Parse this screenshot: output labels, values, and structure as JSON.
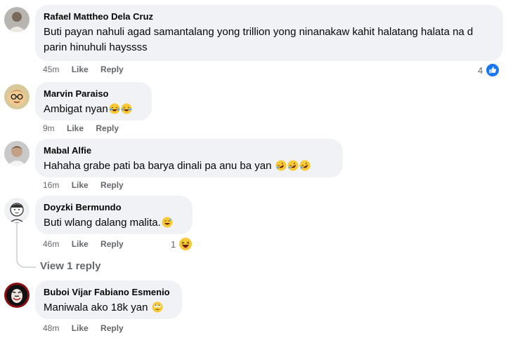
{
  "comments": [
    {
      "author": "Rafael Mattheo Dela Cruz",
      "text": "Buti payan nahuli agad samantalang yong trillion yong ninanakaw kahit halatang halata na d parin hinuhuli hayssss",
      "time": "45m",
      "like": "Like",
      "reply": "Reply",
      "reaction_count": "4",
      "reaction_icon": "like-reaction-icon"
    },
    {
      "author": "Marvin Paraiso",
      "text": "Ambigat nyan",
      "time": "9m",
      "like": "Like",
      "reply": "Reply",
      "emojis": [
        "laughing-tears-emoji",
        "laughing-tears-emoji"
      ]
    },
    {
      "author": "Mabal Alfie",
      "text": "Hahaha grabe pati ba barya dinali pa anu ba yan",
      "time": "16m",
      "like": "Like",
      "reply": "Reply",
      "emojis": [
        "rofl-emoji",
        "rofl-emoji",
        "rofl-emoji"
      ]
    },
    {
      "author": "Doyzki Bermundo",
      "text": "Buti wlang dalang malita.",
      "time": "46m",
      "like": "Like",
      "reply": "Reply",
      "reaction_count": "1",
      "reaction_icon": "haha-reaction-icon",
      "emojis": [
        "grinning-sweat-emoji"
      ],
      "view_replies": "View 1 reply"
    },
    {
      "author": "Buboi Vijar Fabiano Esmenio",
      "text": "Maniwala ako 18k yan",
      "time": "48m",
      "like": "Like",
      "reply": "Reply",
      "emojis": [
        "rolling-eyes-emoji"
      ]
    }
  ],
  "colors": {
    "bubble": "#f0f2f5",
    "meta": "#65676b",
    "like_blue": "#1877f2",
    "emoji_yellow": "#f7c935"
  }
}
